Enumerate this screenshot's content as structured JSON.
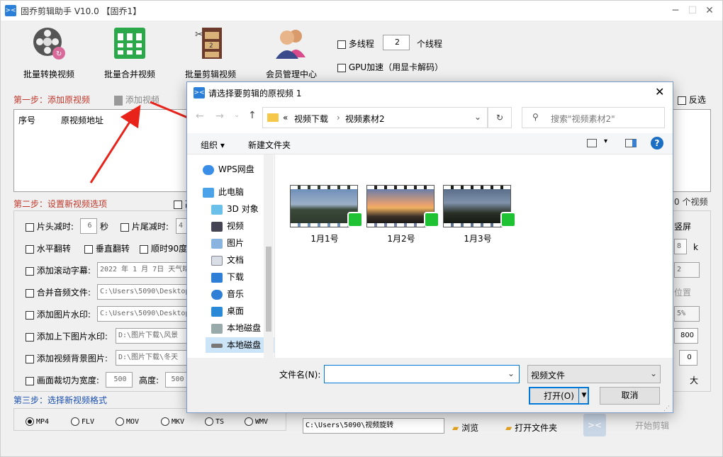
{
  "app": {
    "title": "固乔剪辑助手 V10.0 【固乔1】",
    "toolbar": [
      {
        "label": "批量转换视频",
        "icon": "film-reel-icon"
      },
      {
        "label": "批量合并视频",
        "icon": "merge-grid-icon"
      },
      {
        "label": "批量剪辑视频",
        "icon": "film-strip-icon"
      },
      {
        "label": "会员管理中心",
        "icon": "users-icon"
      }
    ],
    "multithread_label": "多线程",
    "thread_count": "2",
    "thread_unit": "个线程",
    "gpu_label": "GPU加速（用显卡解码）",
    "step1": "第一步：添加原视频",
    "add_video": "添加视频",
    "invert_select": "反选",
    "col_index": "序号",
    "col_path": "原视频地址",
    "step2": "第二步：设置新视频选项",
    "high_label": "高",
    "count_label": "0 个视频",
    "head_cut": "片头减时:",
    "head_value": "6",
    "sec": "秒",
    "tail_cut": "片尾减时:",
    "tail_value": "4",
    "hflip": "水平翻转",
    "vflip": "垂直翻转",
    "rot90": "顺时90度",
    "scroll_text": "添加滚动字幕:",
    "scroll_value": "2022 年 1 月 7日 天气晴",
    "merge_audio": "合并音频文件:",
    "merge_audio_value": "C:\\Users\\5090\\Desktop",
    "img_watermark": "添加图片水印:",
    "img_watermark_value": "C:\\Users\\5090\\Desktop",
    "topbottom_img": "添加上下图片水印:",
    "topbottom_value": "D:\\图片下载\\风景",
    "bg_img": "添加视频背景图片:",
    "bg_value": "D:\\图片下载\\冬天",
    "crop_width": "画面裁切为宽度:",
    "crop_w_value": "500",
    "height_label": "高度:",
    "crop_h_value": "500",
    "right_screen": "竖屏",
    "right_val1": "8",
    "right_k": "k",
    "right_val2": "2",
    "right_position": "位置",
    "right_pct": "5%",
    "right_800": "800",
    "right_zero": "0",
    "right_big": "大",
    "step3": "第三步：选择新视频格式",
    "formats": [
      "MP4",
      "FLV",
      "MOV",
      "MKV",
      "TS",
      "WMV"
    ],
    "output_path": "C:\\Users\\5090\\视频旋转",
    "browse": "浏览",
    "open_folder": "打开文件夹",
    "start_edit": "开始剪辑"
  },
  "dialog": {
    "title": "请选择要剪辑的原视频 1",
    "breadcrumb": [
      "视频下载",
      "视频素材2"
    ],
    "crumb_prefix": "«",
    "search_placeholder": "搜索\"视频素材2\"",
    "organize": "组织",
    "new_folder": "新建文件夹",
    "nav": [
      "WPS网盘",
      "此电脑",
      "3D 对象",
      "视频",
      "图片",
      "文档",
      "下载",
      "音乐",
      "桌面",
      "本地磁盘",
      "本地磁盘"
    ],
    "files": [
      "1月1号",
      "1月2号",
      "1月3号"
    ],
    "filename_label": "文件名(N):",
    "filename_value": "",
    "filetype": "视频文件",
    "open_btn": "打开(O)",
    "cancel_btn": "取消"
  },
  "colors": {
    "accent": "#2a80d8",
    "step_red": "#c0382b",
    "step_blue": "#1a4fb0",
    "arrow": "#e8231a",
    "wps_green": "#1ec232"
  }
}
